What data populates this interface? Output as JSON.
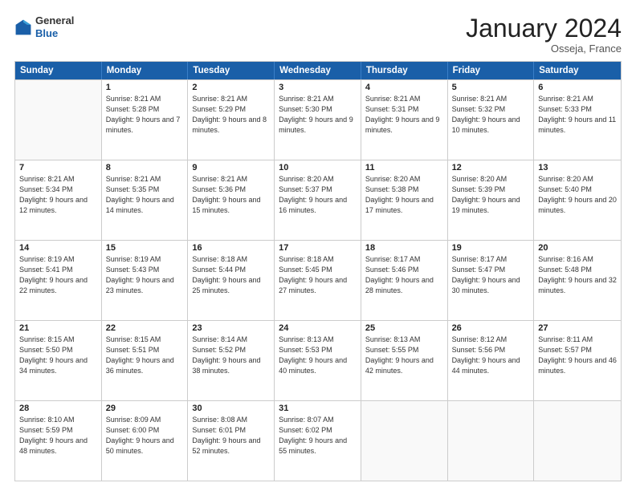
{
  "header": {
    "logo_general": "General",
    "logo_blue": "Blue",
    "month_title": "January 2024",
    "location": "Osseja, France"
  },
  "days_of_week": [
    "Sunday",
    "Monday",
    "Tuesday",
    "Wednesday",
    "Thursday",
    "Friday",
    "Saturday"
  ],
  "weeks": [
    [
      {
        "day": "",
        "sunrise": "",
        "sunset": "",
        "daylight": ""
      },
      {
        "day": "1",
        "sunrise": "Sunrise: 8:21 AM",
        "sunset": "Sunset: 5:28 PM",
        "daylight": "Daylight: 9 hours and 7 minutes."
      },
      {
        "day": "2",
        "sunrise": "Sunrise: 8:21 AM",
        "sunset": "Sunset: 5:29 PM",
        "daylight": "Daylight: 9 hours and 8 minutes."
      },
      {
        "day": "3",
        "sunrise": "Sunrise: 8:21 AM",
        "sunset": "Sunset: 5:30 PM",
        "daylight": "Daylight: 9 hours and 9 minutes."
      },
      {
        "day": "4",
        "sunrise": "Sunrise: 8:21 AM",
        "sunset": "Sunset: 5:31 PM",
        "daylight": "Daylight: 9 hours and 9 minutes."
      },
      {
        "day": "5",
        "sunrise": "Sunrise: 8:21 AM",
        "sunset": "Sunset: 5:32 PM",
        "daylight": "Daylight: 9 hours and 10 minutes."
      },
      {
        "day": "6",
        "sunrise": "Sunrise: 8:21 AM",
        "sunset": "Sunset: 5:33 PM",
        "daylight": "Daylight: 9 hours and 11 minutes."
      }
    ],
    [
      {
        "day": "7",
        "sunrise": "Sunrise: 8:21 AM",
        "sunset": "Sunset: 5:34 PM",
        "daylight": "Daylight: 9 hours and 12 minutes."
      },
      {
        "day": "8",
        "sunrise": "Sunrise: 8:21 AM",
        "sunset": "Sunset: 5:35 PM",
        "daylight": "Daylight: 9 hours and 14 minutes."
      },
      {
        "day": "9",
        "sunrise": "Sunrise: 8:21 AM",
        "sunset": "Sunset: 5:36 PM",
        "daylight": "Daylight: 9 hours and 15 minutes."
      },
      {
        "day": "10",
        "sunrise": "Sunrise: 8:20 AM",
        "sunset": "Sunset: 5:37 PM",
        "daylight": "Daylight: 9 hours and 16 minutes."
      },
      {
        "day": "11",
        "sunrise": "Sunrise: 8:20 AM",
        "sunset": "Sunset: 5:38 PM",
        "daylight": "Daylight: 9 hours and 17 minutes."
      },
      {
        "day": "12",
        "sunrise": "Sunrise: 8:20 AM",
        "sunset": "Sunset: 5:39 PM",
        "daylight": "Daylight: 9 hours and 19 minutes."
      },
      {
        "day": "13",
        "sunrise": "Sunrise: 8:20 AM",
        "sunset": "Sunset: 5:40 PM",
        "daylight": "Daylight: 9 hours and 20 minutes."
      }
    ],
    [
      {
        "day": "14",
        "sunrise": "Sunrise: 8:19 AM",
        "sunset": "Sunset: 5:41 PM",
        "daylight": "Daylight: 9 hours and 22 minutes."
      },
      {
        "day": "15",
        "sunrise": "Sunrise: 8:19 AM",
        "sunset": "Sunset: 5:43 PM",
        "daylight": "Daylight: 9 hours and 23 minutes."
      },
      {
        "day": "16",
        "sunrise": "Sunrise: 8:18 AM",
        "sunset": "Sunset: 5:44 PM",
        "daylight": "Daylight: 9 hours and 25 minutes."
      },
      {
        "day": "17",
        "sunrise": "Sunrise: 8:18 AM",
        "sunset": "Sunset: 5:45 PM",
        "daylight": "Daylight: 9 hours and 27 minutes."
      },
      {
        "day": "18",
        "sunrise": "Sunrise: 8:17 AM",
        "sunset": "Sunset: 5:46 PM",
        "daylight": "Daylight: 9 hours and 28 minutes."
      },
      {
        "day": "19",
        "sunrise": "Sunrise: 8:17 AM",
        "sunset": "Sunset: 5:47 PM",
        "daylight": "Daylight: 9 hours and 30 minutes."
      },
      {
        "day": "20",
        "sunrise": "Sunrise: 8:16 AM",
        "sunset": "Sunset: 5:48 PM",
        "daylight": "Daylight: 9 hours and 32 minutes."
      }
    ],
    [
      {
        "day": "21",
        "sunrise": "Sunrise: 8:15 AM",
        "sunset": "Sunset: 5:50 PM",
        "daylight": "Daylight: 9 hours and 34 minutes."
      },
      {
        "day": "22",
        "sunrise": "Sunrise: 8:15 AM",
        "sunset": "Sunset: 5:51 PM",
        "daylight": "Daylight: 9 hours and 36 minutes."
      },
      {
        "day": "23",
        "sunrise": "Sunrise: 8:14 AM",
        "sunset": "Sunset: 5:52 PM",
        "daylight": "Daylight: 9 hours and 38 minutes."
      },
      {
        "day": "24",
        "sunrise": "Sunrise: 8:13 AM",
        "sunset": "Sunset: 5:53 PM",
        "daylight": "Daylight: 9 hours and 40 minutes."
      },
      {
        "day": "25",
        "sunrise": "Sunrise: 8:13 AM",
        "sunset": "Sunset: 5:55 PM",
        "daylight": "Daylight: 9 hours and 42 minutes."
      },
      {
        "day": "26",
        "sunrise": "Sunrise: 8:12 AM",
        "sunset": "Sunset: 5:56 PM",
        "daylight": "Daylight: 9 hours and 44 minutes."
      },
      {
        "day": "27",
        "sunrise": "Sunrise: 8:11 AM",
        "sunset": "Sunset: 5:57 PM",
        "daylight": "Daylight: 9 hours and 46 minutes."
      }
    ],
    [
      {
        "day": "28",
        "sunrise": "Sunrise: 8:10 AM",
        "sunset": "Sunset: 5:59 PM",
        "daylight": "Daylight: 9 hours and 48 minutes."
      },
      {
        "day": "29",
        "sunrise": "Sunrise: 8:09 AM",
        "sunset": "Sunset: 6:00 PM",
        "daylight": "Daylight: 9 hours and 50 minutes."
      },
      {
        "day": "30",
        "sunrise": "Sunrise: 8:08 AM",
        "sunset": "Sunset: 6:01 PM",
        "daylight": "Daylight: 9 hours and 52 minutes."
      },
      {
        "day": "31",
        "sunrise": "Sunrise: 8:07 AM",
        "sunset": "Sunset: 6:02 PM",
        "daylight": "Daylight: 9 hours and 55 minutes."
      },
      {
        "day": "",
        "sunrise": "",
        "sunset": "",
        "daylight": ""
      },
      {
        "day": "",
        "sunrise": "",
        "sunset": "",
        "daylight": ""
      },
      {
        "day": "",
        "sunrise": "",
        "sunset": "",
        "daylight": ""
      }
    ]
  ]
}
